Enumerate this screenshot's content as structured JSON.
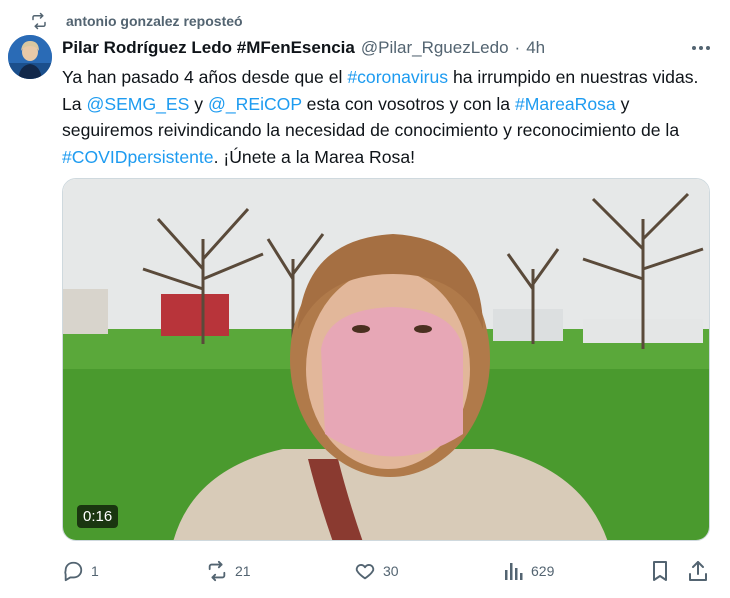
{
  "repost": {
    "text": "antonio gonzalez reposteó",
    "icon": "repost-icon"
  },
  "tweet": {
    "author_name": "Pilar Rodríguez Ledo #MFenEsencia",
    "handle": "@Pilar_RguezLedo",
    "separator": "·",
    "time": "4h",
    "text_parts": [
      {
        "t": "Ya han pasado 4 años desde que el "
      },
      {
        "t": "#coronavirus",
        "link": true
      },
      {
        "t": " ha irrumpido en nuestras vidas. La "
      },
      {
        "t": "@SEMG_ES",
        "link": true
      },
      {
        "t": " y "
      },
      {
        "t": "@_REiCOP",
        "link": true
      },
      {
        "t": " esta con vosotros y con la "
      },
      {
        "t": "#MareaRosa",
        "link": true
      },
      {
        "t": " y seguiremos reivindicando la necesidad de conocimiento y reconocimiento de la "
      },
      {
        "t": "#COVIDpersistente",
        "link": true
      },
      {
        "t": ". ¡Únete a la Marea Rosa!"
      }
    ],
    "video_duration": "0:16"
  },
  "actions": {
    "replies": "1",
    "reposts": "21",
    "likes": "30",
    "views": "629"
  },
  "colors": {
    "link": "#1d9bf0",
    "muted": "#536471",
    "text": "#0f1419"
  }
}
